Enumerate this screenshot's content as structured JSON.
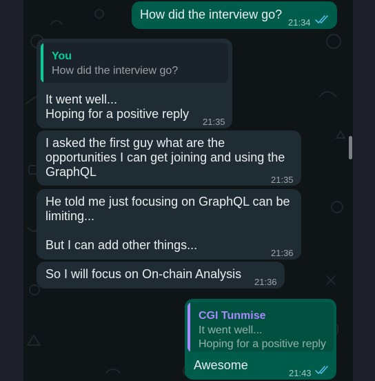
{
  "colors": {
    "incoming_bubble": "#202c33",
    "outgoing_bubble": "#005c4b",
    "chat_background": "#0f1417",
    "read_ticks": "#53bdeb",
    "quote_you_accent": "#06cf9c",
    "quote_contact_accent": "#a78bfa"
  },
  "messages": [
    {
      "direction": "outgoing",
      "text": "How did the interview go?",
      "time": "21:34",
      "status": "read"
    },
    {
      "direction": "incoming",
      "quote": {
        "author": "You",
        "text": "How did the interview go?"
      },
      "text": "It went well...\nHoping for a positive reply",
      "time": "21:35"
    },
    {
      "direction": "incoming",
      "text": "I asked the first guy what are the\nopportunities I can get joining and using the\nGraphQL",
      "time": "21:35"
    },
    {
      "direction": "incoming",
      "text": "He told me just focusing on GraphQL can be\nlimiting...\n\nBut I can add other things...",
      "time": "21:36"
    },
    {
      "direction": "incoming",
      "text": "So I will focus on On-chain Analysis",
      "time": "21:36"
    },
    {
      "direction": "outgoing",
      "quote": {
        "author": "CGI Tunmise",
        "text": "It went well...\nHoping for a positive reply"
      },
      "text": "Awesome",
      "time": "21:43",
      "status": "read"
    }
  ]
}
